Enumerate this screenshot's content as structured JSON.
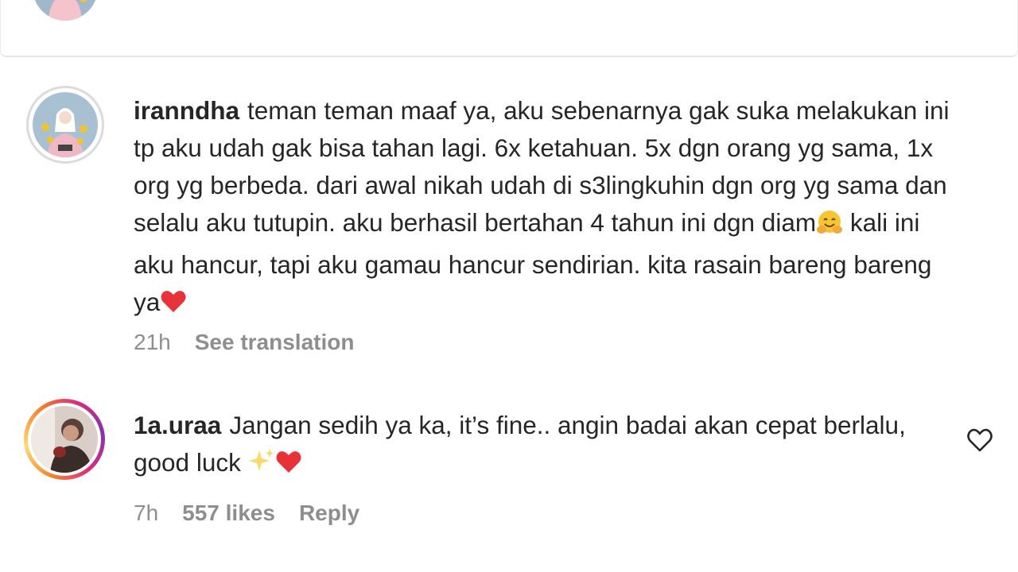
{
  "top": {
    "username": "iranndha"
  },
  "comments": [
    {
      "username": "iranndha",
      "text_parts": [
        "teman teman maaf ya, aku sebenarnya gak suka melakukan ini tp aku udah gak bisa tahan lagi. 6x ketahuan. 5x dgn orang yg sama, 1x org yg berbeda. dari awal nikah udah di s3lingkuhin dgn org yg sama dan selalu aku tutupin. aku berhasil bertahan 4 tahun ini dgn diam",
        "kali ini aku hancur, tapi aku gamau hancur sendirian. kita rasain bareng bareng ya"
      ],
      "emojis": [
        "hugging-face",
        "red-heart"
      ],
      "time": "21h",
      "see_translation": "See translation"
    },
    {
      "username": "1a.uraa",
      "text_parts": [
        "Jangan sedih ya ka, it’s fine.. angin badai akan cepat berlalu, good luck "
      ],
      "emojis": [
        "sparkles",
        "red-heart"
      ],
      "time": "7h",
      "likes": "557 likes",
      "reply": "Reply"
    }
  ],
  "icons": {
    "like": "heart-outline-icon"
  },
  "colors": {
    "text": "#262626",
    "meta": "#8e8e8e",
    "heart": "#e0245e"
  }
}
